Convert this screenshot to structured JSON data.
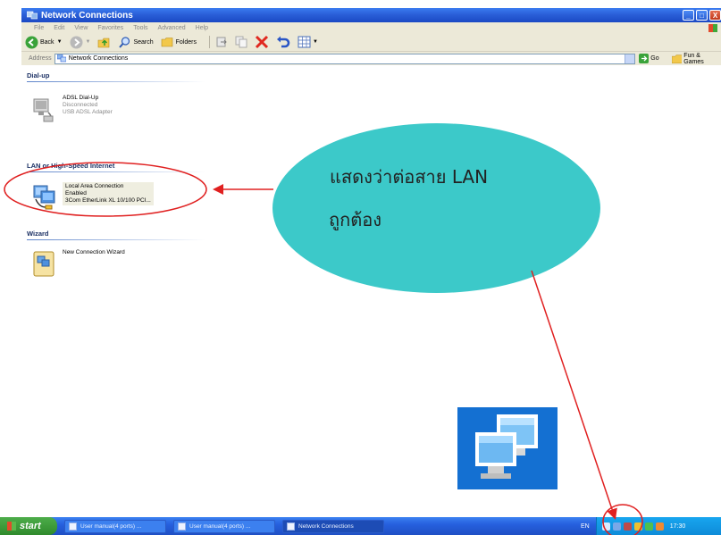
{
  "window": {
    "title": "Network Connections",
    "buttons": {
      "minimize": "_",
      "maximize": "□",
      "close": "X"
    }
  },
  "menu": [
    "File",
    "Edit",
    "View",
    "Favorites",
    "Tools",
    "Advanced",
    "Help"
  ],
  "toolbar": {
    "back": "Back",
    "search": "Search",
    "folders": "Folders"
  },
  "address": {
    "label": "Address",
    "value": "Network Connections",
    "go": "Go",
    "links": "Fun & Games"
  },
  "groups": {
    "dialup": {
      "header": "Dial-up",
      "items": [
        {
          "name": "ADSL Dial-Up",
          "status": "Disconnected",
          "device": "USB ADSL Adapter"
        }
      ]
    },
    "lan": {
      "header": "LAN or High-Speed Internet",
      "items": [
        {
          "name": "Local Area Connection",
          "status": "Enabled",
          "device": "3Com EtherLink XL 10/100 PCI..."
        }
      ]
    },
    "wizard": {
      "header": "Wizard",
      "items": [
        {
          "name": "New Connection Wizard"
        }
      ]
    }
  },
  "callout": {
    "line1": "แสดงว่าต่อสาย LAN",
    "line2": "ถูกต้อง"
  },
  "taskbar": {
    "start": "start",
    "tasks": [
      "User manual(4 ports) ...",
      "User manual(4 ports) ...",
      "Network Connections"
    ],
    "lang": "EN",
    "clock": "17:30"
  },
  "colors": {
    "callout_fill": "#3cc9c9",
    "annotation_red": "#e02020",
    "xp_blue": "#2a5fd8"
  }
}
